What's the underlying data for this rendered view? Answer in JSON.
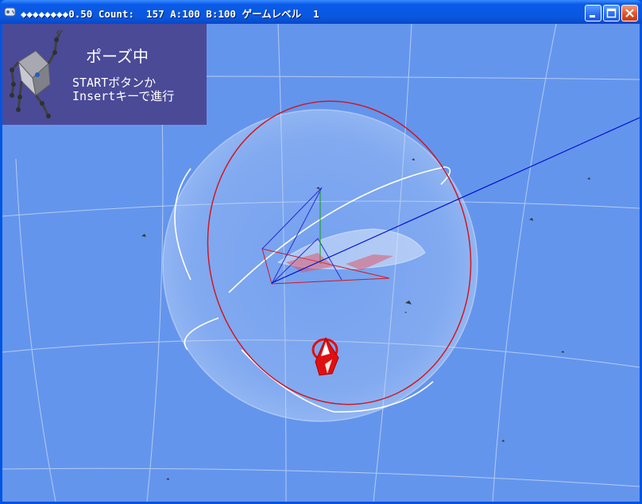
{
  "window": {
    "title": "◆◆◆◆◆◆◆◆0.50 Count:  157 A:100 B:100 ゲームレベル  1",
    "buttons": [
      "minimize",
      "maximize",
      "close"
    ]
  },
  "pause_overlay": {
    "title": "ポーズ中",
    "line1": "STARTボタンか",
    "line2": "Insertキーで進行"
  },
  "colors": {
    "background": "#6495ed",
    "panel": "#4b4a97",
    "title_bar": "#0a58e0",
    "orbit_ring": "#d01820",
    "axis_blue": "#0010d0",
    "player": "#e01010"
  },
  "icons": [
    "app-icon",
    "minimize-icon",
    "maximize-icon",
    "close-icon"
  ]
}
